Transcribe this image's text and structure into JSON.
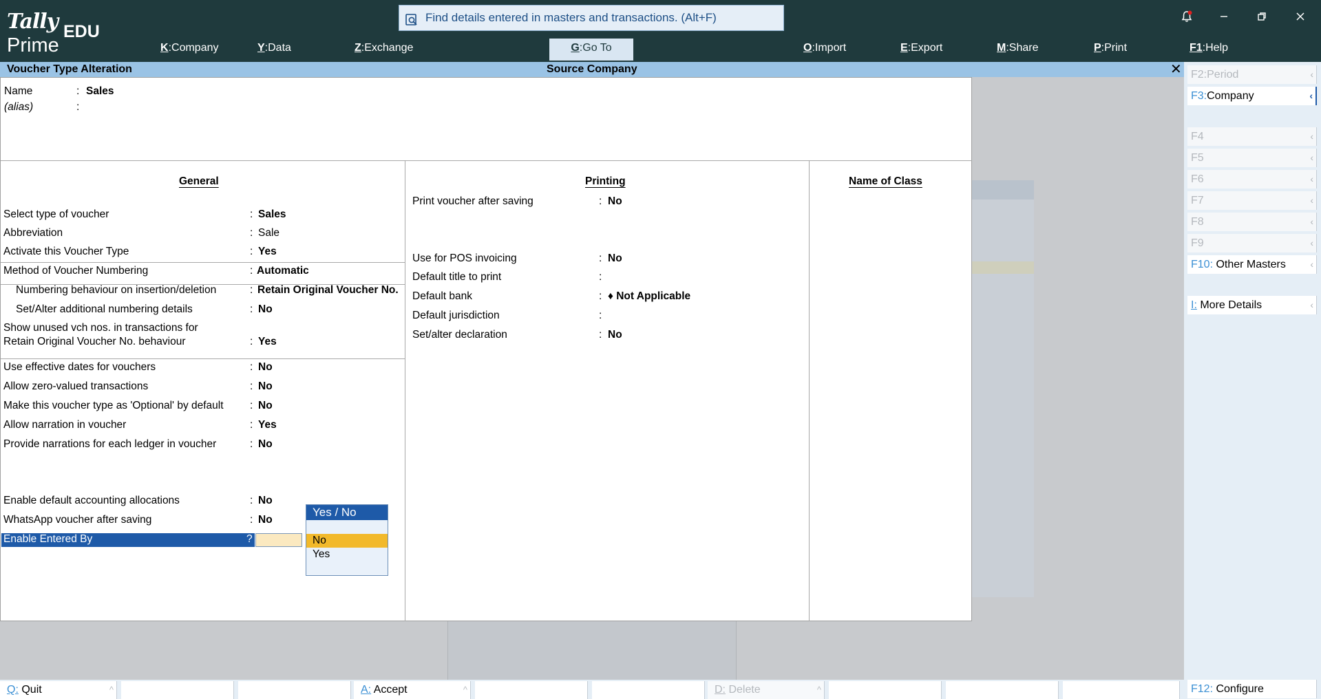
{
  "app": {
    "logo_top": "Tally",
    "logo_bottom": "Prime",
    "edition": "EDU",
    "search_placeholder": "Find details entered in masters and transactions. (Alt+F)"
  },
  "topmenu": [
    {
      "key": "K",
      "label": "Company"
    },
    {
      "key": "Y",
      "label": "Data"
    },
    {
      "key": "Z",
      "label": "Exchange"
    },
    {
      "key": "G",
      "label": "Go To"
    },
    {
      "key": "O",
      "label": "Import"
    },
    {
      "key": "E",
      "label": "Export"
    },
    {
      "key": "M",
      "label": "Share"
    },
    {
      "key": "P",
      "label": "Print"
    },
    {
      "key": "F1",
      "label": "Help"
    }
  ],
  "titlebar": {
    "left": "Voucher Type Alteration",
    "center": "Source Company",
    "close": "✕"
  },
  "header": {
    "name_label": "Name",
    "name_value": "Sales",
    "alias_label": "(alias)"
  },
  "general": {
    "heading": "General",
    "rows": [
      {
        "label": "Select type of voucher",
        "value": "Sales",
        "bold": true
      },
      {
        "label": "Abbreviation",
        "value": "Sale",
        "bold": false
      },
      {
        "label": "Activate this Voucher Type",
        "value": "Yes",
        "bold": true
      },
      {
        "label": "Method of Voucher Numbering",
        "value": "Automatic",
        "bold": true
      },
      {
        "label": "Numbering behaviour on insertion/deletion",
        "value": "Retain Original Voucher No.",
        "bold": true
      },
      {
        "label": "Set/Alter additional numbering details",
        "value": "No",
        "bold": true
      },
      {
        "label": "Show unused vch nos. in transactions for",
        "value": "",
        "bold": true
      },
      {
        "label": "Retain Original Voucher No. behaviour",
        "value": "Yes",
        "bold": true
      },
      {
        "label": "Use effective dates for vouchers",
        "value": "No",
        "bold": true
      },
      {
        "label": "Allow zero-valued transactions",
        "value": "No",
        "bold": true
      },
      {
        "label": "Make this voucher type as 'Optional' by default",
        "value": "No",
        "bold": true
      },
      {
        "label": "Allow narration in voucher",
        "value": "Yes",
        "bold": true
      },
      {
        "label": "Provide narrations for each ledger in voucher",
        "value": "No",
        "bold": true
      },
      {
        "label": "Enable default accounting allocations",
        "value": "No",
        "bold": true
      },
      {
        "label": "WhatsApp voucher after saving",
        "value": "No",
        "bold": true
      }
    ],
    "active_label": "Enable Entered By",
    "active_marker": "?"
  },
  "printing": {
    "heading": "Printing",
    "rows": [
      {
        "label": "Print voucher after saving",
        "value": "No"
      },
      {
        "label": "Use for POS invoicing",
        "value": "No"
      },
      {
        "label": "Default title to print",
        "value": ""
      },
      {
        "label": "Default bank",
        "value": "♦ Not Applicable"
      },
      {
        "label": "Default jurisdiction",
        "value": ""
      },
      {
        "label": "Set/alter declaration",
        "value": "No"
      }
    ]
  },
  "class_section": {
    "heading": "Name of Class"
  },
  "popup": {
    "title": "Yes / No",
    "options": [
      "No",
      "Yes"
    ],
    "selected": "No"
  },
  "rightpanel": [
    {
      "key": "F2:",
      "label": "Period",
      "disabled": true
    },
    {
      "key": "F3:",
      "label": "Company",
      "disabled": false
    },
    {
      "key": "F4",
      "label": "",
      "disabled": true
    },
    {
      "key": "F5",
      "label": "",
      "disabled": true
    },
    {
      "key": "F6",
      "label": "",
      "disabled": true
    },
    {
      "key": "F7",
      "label": "",
      "disabled": true
    },
    {
      "key": "F8",
      "label": "",
      "disabled": true
    },
    {
      "key": "F9",
      "label": "",
      "disabled": true
    },
    {
      "key": "F10:",
      "label": "Other Masters",
      "disabled": false
    },
    {
      "key": "I:",
      "label": "More Details",
      "disabled": false
    },
    {
      "key": "F12:",
      "label": "Configure",
      "disabled": false
    }
  ],
  "bottombar": [
    {
      "key": "Q:",
      "label": "Quit",
      "disabled": false
    },
    {
      "key": "A:",
      "label": "Accept",
      "disabled": false
    },
    {
      "key": "D:",
      "label": "Delete",
      "disabled": true
    }
  ],
  "icons": {
    "search": "search-icon",
    "bell": "notification-bell-icon",
    "minimize": "minimize-icon",
    "restore": "restore-icon",
    "close": "close-icon"
  },
  "colors": {
    "topbar": "#1f3a3d",
    "titlebar": "#9ac3e5",
    "active_row": "#1e5aa8",
    "selected_option": "#f2b92b",
    "key_accent": "#3a8fd4"
  }
}
